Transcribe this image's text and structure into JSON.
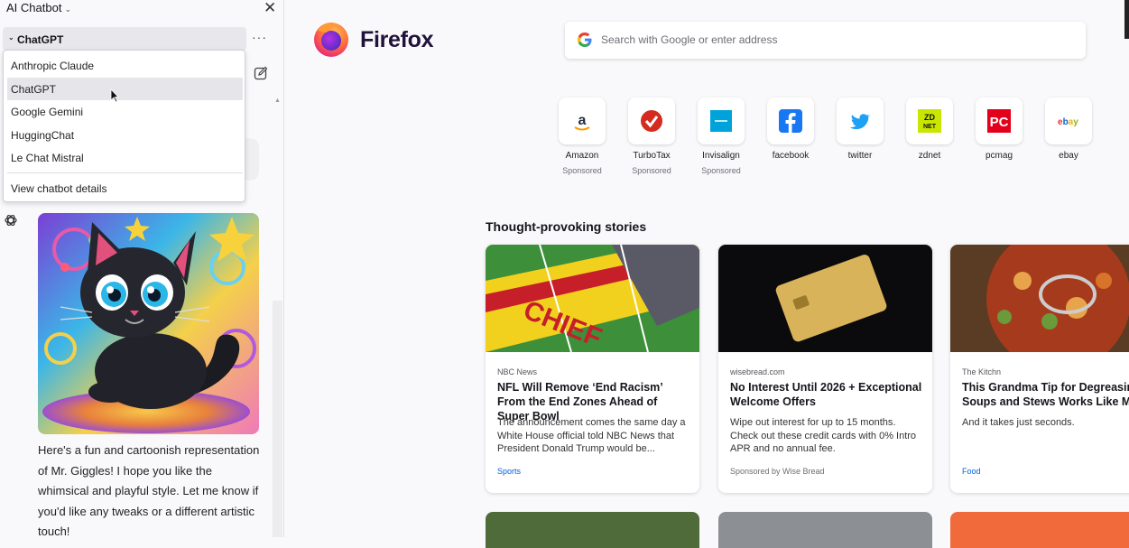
{
  "sidebar": {
    "title": "AI Chatbot",
    "provider_selected": "ChatGPT",
    "more_label": "···",
    "dropdown": {
      "items": [
        {
          "label": "Anthropic Claude"
        },
        {
          "label": "ChatGPT",
          "selected": true
        },
        {
          "label": "Google Gemini"
        },
        {
          "label": "HuggingChat"
        },
        {
          "label": "Le Chat Mistral"
        }
      ],
      "details_label": "View chatbot details"
    },
    "reply_text": "Here's a fun and cartoonish representation of Mr. Giggles! I hope you like the whimsical and playful style. Let me know if you'd like any tweaks or a different artistic touch!"
  },
  "header": {
    "brand": "Firefox",
    "search_placeholder": "Search with Google or enter address"
  },
  "shortcuts": [
    {
      "label": "Amazon",
      "sponsored": "Sponsored",
      "icon": "amazon-icon",
      "color": "#232f3e"
    },
    {
      "label": "TurboTax",
      "sponsored": "Sponsored",
      "icon": "turbotax-icon",
      "color": "#d52b1e"
    },
    {
      "label": "Invisalign",
      "sponsored": "Sponsored",
      "icon": "invisalign-icon",
      "color": "#00a3d9"
    },
    {
      "label": "facebook",
      "sponsored": "",
      "icon": "facebook-icon",
      "color": "#1877f2"
    },
    {
      "label": "twitter",
      "sponsored": "",
      "icon": "twitter-icon",
      "color": "#1da1f2"
    },
    {
      "label": "zdnet",
      "sponsored": "",
      "icon": "zdnet-icon",
      "color": "#c8e600"
    },
    {
      "label": "pcmag",
      "sponsored": "",
      "icon": "pcmag-icon",
      "color": "#e3001b"
    },
    {
      "label": "ebay",
      "sponsored": "",
      "icon": "ebay-icon",
      "color": "#e53238"
    }
  ],
  "stories": {
    "heading": "Thought-provoking stories",
    "cards": [
      {
        "source": "NBC News",
        "title": "NFL Will Remove ‘End Racism’ From the End Zones Ahead of Super Bowl",
        "desc": "The announcement comes the same day a White House official told NBC News that President Donald Trump would be...",
        "context": "Sports"
      },
      {
        "source": "wisebread.com",
        "title": "No Interest Until 2026 + Exceptional Welcome Offers",
        "desc": "Wipe out interest for up to 15 months. Check out these credit cards with 0% Intro APR and no annual fee.",
        "context": "Sponsored by Wise Bread"
      },
      {
        "source": "The Kitchn",
        "title": "This Grandma Tip for Degreasing Soups and Stews Works Like Magic",
        "desc": "And it takes just seconds.",
        "context": "Food"
      }
    ]
  }
}
